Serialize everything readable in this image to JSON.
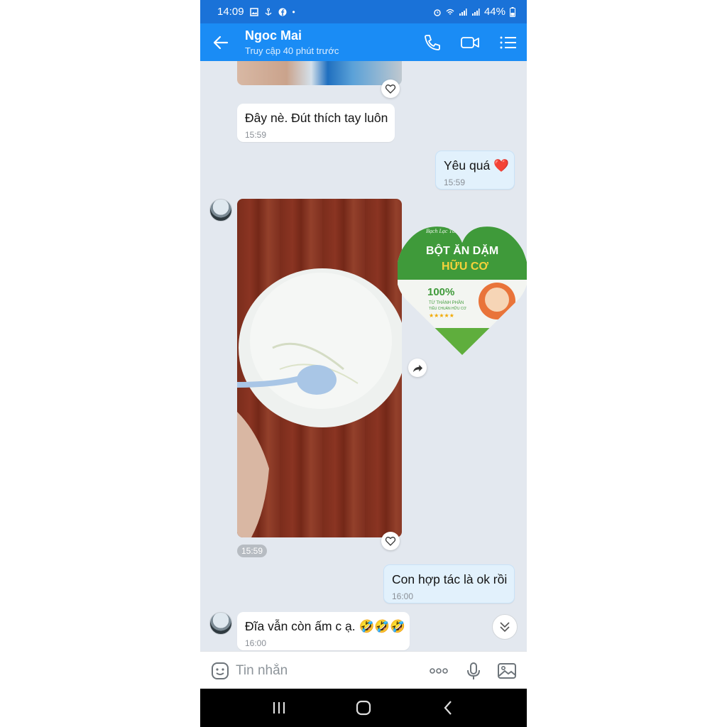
{
  "status_bar": {
    "time": "14:09",
    "battery": "44%"
  },
  "header": {
    "title": "Ngoc Mai",
    "subtitle": "Truy cập 40 phút trước"
  },
  "messages": [
    {
      "text": "Đây nè. Đút thích tay luôn",
      "time": "15:59"
    },
    {
      "text": "Yêu quá ❤️",
      "time": "15:59"
    },
    {
      "photo_time": "15:59"
    },
    {
      "text": "Con hợp tác là ok rồi",
      "time": "16:00"
    },
    {
      "text": "Đĩa vẫn còn ấm c ạ. 🤣🤣🤣",
      "time": "16:00"
    }
  ],
  "sticker": {
    "brand": "Bạch Lạc Tâm",
    "line1": "BỘT ĂN DẶM",
    "line2": "HỮU CƠ",
    "percent": "100%",
    "tag1": "TỪ THÀNH PHẦN",
    "tag2": "TIÊU CHUẨN HỮU CƠ"
  },
  "input": {
    "placeholder": "Tin nhắn"
  },
  "colors": {
    "header": "#1a8cf5",
    "statusbar": "#1a72d8",
    "chat_bg": "#e3e8ef",
    "outgoing": "#e2f1fc"
  },
  "icons": [
    "back-arrow-icon",
    "phone-icon",
    "video-call-icon",
    "menu-icon",
    "heart-icon",
    "share-icon",
    "chevron-double-down-icon",
    "emoji-icon",
    "more-icon",
    "microphone-icon",
    "image-icon",
    "recents-icon",
    "home-icon",
    "back-icon"
  ]
}
